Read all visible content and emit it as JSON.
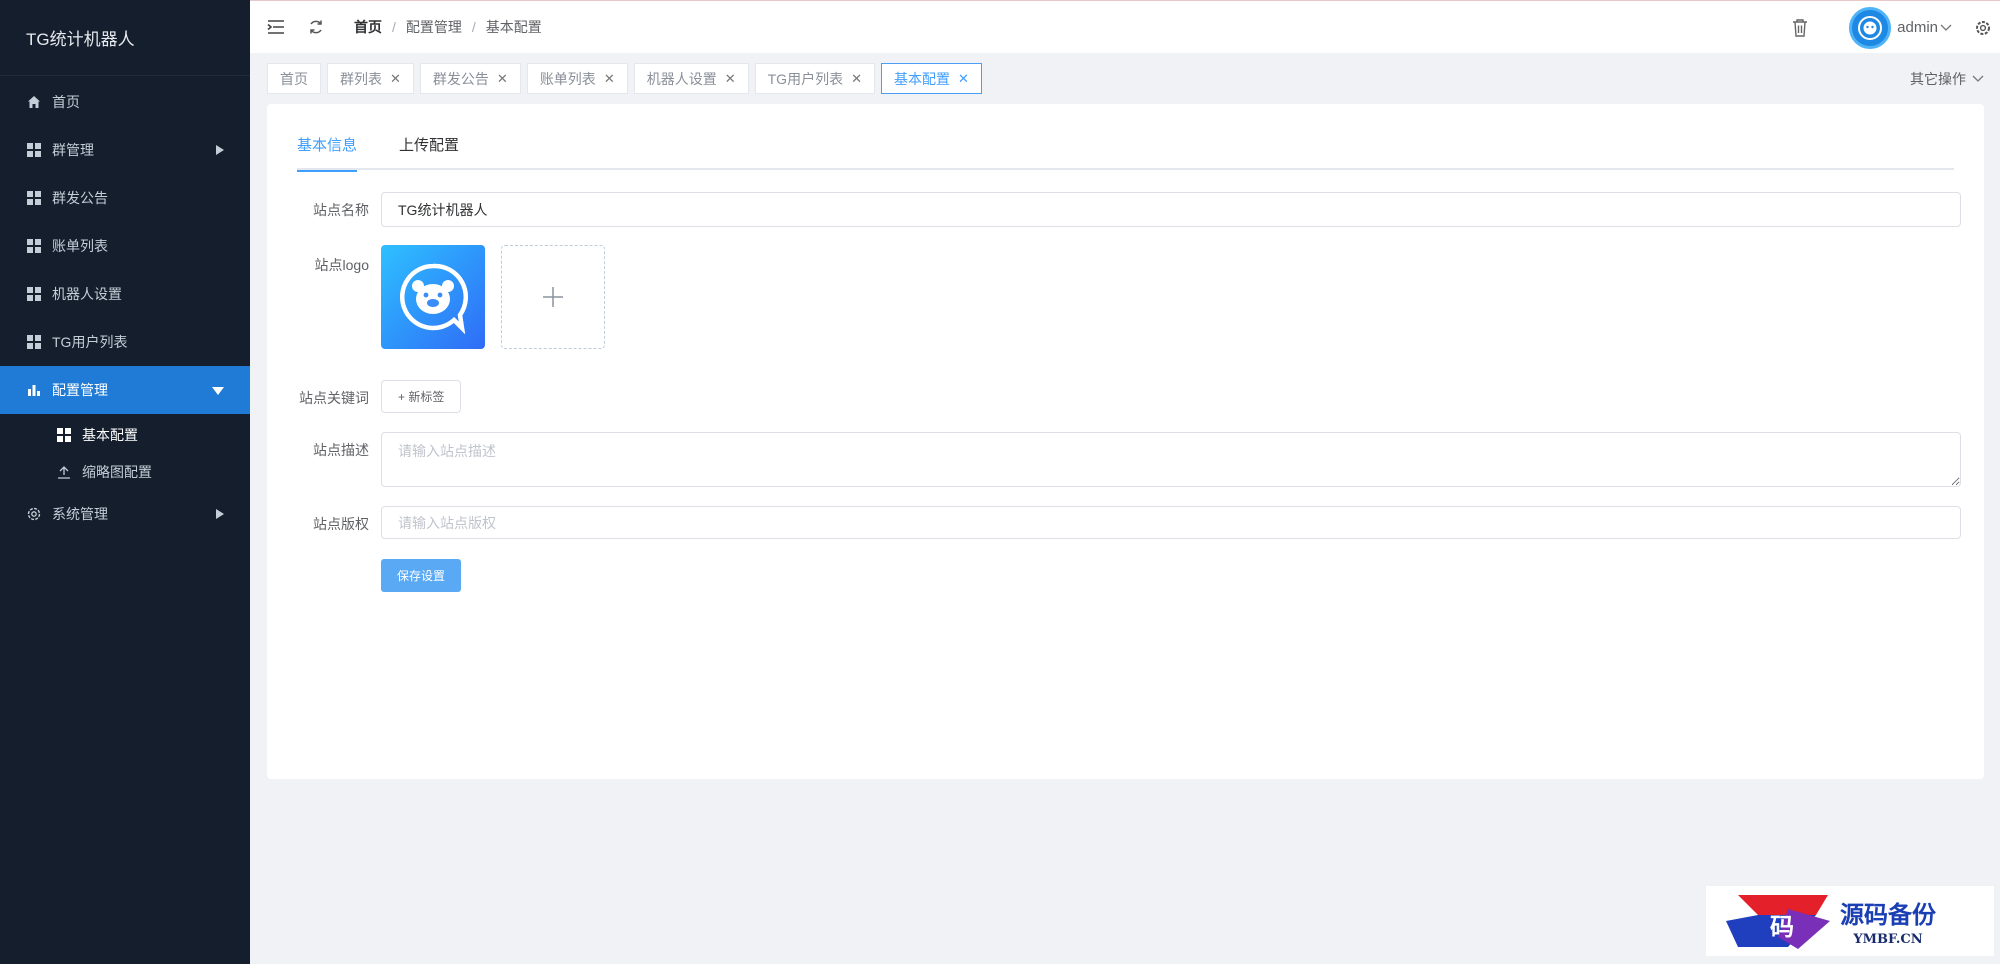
{
  "sidebar": {
    "brand": "TG统计机器人",
    "items": [
      {
        "label": "首页",
        "icon": "home-icon"
      },
      {
        "label": "群管理",
        "icon": "grid-icon"
      },
      {
        "label": "群发公告",
        "icon": "grid-icon"
      },
      {
        "label": "账单列表",
        "icon": "grid-icon"
      },
      {
        "label": "机器人设置",
        "icon": "grid-icon"
      },
      {
        "label": "TG用户列表",
        "icon": "grid-icon"
      },
      {
        "label": "配置管理",
        "icon": "bar-chart-icon"
      },
      {
        "label": "系统管理",
        "icon": "gear-icon"
      }
    ],
    "submenu": [
      {
        "label": "基本配置",
        "icon": "grid-icon"
      },
      {
        "label": "缩略图配置",
        "icon": "upload-icon"
      }
    ]
  },
  "header": {
    "breadcrumb": [
      "首页",
      "配置管理",
      "基本配置"
    ],
    "user": "admin"
  },
  "tags": [
    {
      "label": "首页"
    },
    {
      "label": "群列表"
    },
    {
      "label": "群发公告"
    },
    {
      "label": "账单列表"
    },
    {
      "label": "机器人设置"
    },
    {
      "label": "TG用户列表"
    },
    {
      "label": "基本配置"
    }
  ],
  "other_ops": "其它操作",
  "tabs": [
    "基本信息",
    "上传配置"
  ],
  "form": {
    "site_name_label": "站点名称",
    "site_name_value": "TG统计机器人",
    "site_logo_label": "站点logo",
    "keywords_label": "站点关键词",
    "new_tag_button": "+ 新标签",
    "description_label": "站点描述",
    "description_placeholder": "请输入站点描述",
    "copyright_label": "站点版权",
    "copyright_placeholder": "请输入站点版权",
    "save_button": "保存设置"
  },
  "watermark": {
    "main": "源码备份",
    "sub": "YMBF.CN",
    "glyph": "码"
  },
  "colors": {
    "sidebar_bg": "#141e2c",
    "active_menu": "#1f7bd6",
    "accent": "#409eff"
  }
}
